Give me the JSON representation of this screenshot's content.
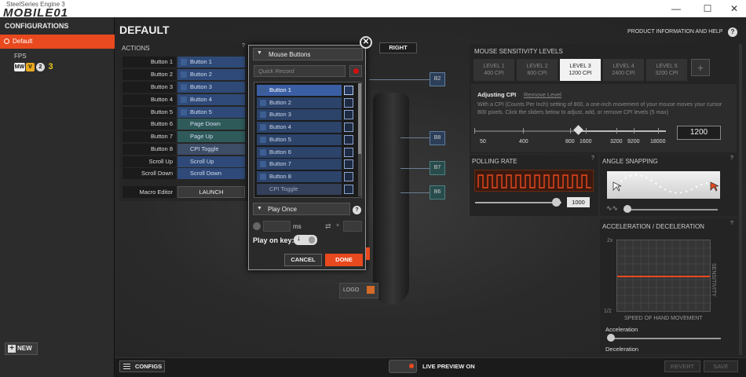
{
  "window": {
    "app_title": "SteelSeries Engine 3",
    "logo_text": "MOBILE01",
    "minimize": "—",
    "maximize": "☐",
    "close": "✕"
  },
  "sidebar": {
    "title": "CONFIGURATIONS",
    "default_item": "Default",
    "fps_item": "FPS",
    "new_button": "NEW",
    "new_icon": "+"
  },
  "main": {
    "title": "DEFAULT",
    "product_info": "PRODUCT INFORMATION AND HELP",
    "product_info_icon": "?",
    "right_tab": "RIGHT"
  },
  "actions": {
    "title": "ACTIONS",
    "help": "?",
    "rows": [
      {
        "label": "Button 1",
        "value": "Button 1"
      },
      {
        "label": "Button 2",
        "value": "Button 2"
      },
      {
        "label": "Button 3",
        "value": "Button 3"
      },
      {
        "label": "Button 4",
        "value": "Button 4"
      },
      {
        "label": "Button 5",
        "value": "Button 5"
      },
      {
        "label": "Button 6",
        "value": "Page Down"
      },
      {
        "label": "Button 7",
        "value": "Page Up"
      },
      {
        "label": "Button 8",
        "value": "CPI Toggle"
      },
      {
        "label": "Scroll Up",
        "value": "Scroll Up"
      },
      {
        "label": "Scroll Down",
        "value": "Scroll Down"
      }
    ],
    "macro_label": "Macro Editor",
    "launch": "LAUNCH"
  },
  "mouse": {
    "callouts": [
      "B2",
      "B8",
      "B7",
      "B6"
    ],
    "logo_label": "LOGO"
  },
  "popup": {
    "close": "✕",
    "header": "Mouse Buttons",
    "quick_record_placeholder": "Quick Record",
    "items": [
      "Button 1",
      "Button 2",
      "Button 3",
      "Button 4",
      "Button 5",
      "Button 6",
      "Button 7",
      "Button 8",
      "CPI Toggle"
    ],
    "play_mode": "Play Once",
    "play_help": "?",
    "ms_label": "ms",
    "times_label": "×",
    "play_on_key": "Play on key:",
    "cancel": "CANCEL",
    "done": "DONE"
  },
  "sensitivity": {
    "title": "MOUSE SENSITIVITY LEVELS",
    "levels": [
      {
        "name": "LEVEL 1",
        "cpi": "400 CPI"
      },
      {
        "name": "LEVEL 2",
        "cpi": "800 CPI"
      },
      {
        "name": "LEVEL 3",
        "cpi": "1200 CPI"
      },
      {
        "name": "LEVEL 4",
        "cpi": "2400 CPI"
      },
      {
        "name": "LEVEL 5",
        "cpi": "3200 CPI"
      }
    ],
    "active_level": 3,
    "add": "+",
    "adjusting": "Adjusting CPI",
    "remove": "Remove Level",
    "description": "With a CPI (Counts Per Inch) setting of 800, a one-inch movement of your mouse moves your cursor 800 pixels. Click the sliders below to adjust, add, or remove CPI levels (5 max)",
    "ticks": [
      "50",
      "400",
      "800",
      "1600",
      "3200",
      "9200",
      "18000"
    ],
    "value": "1200"
  },
  "polling": {
    "title": "POLLING RATE",
    "help": "?",
    "value": "1000"
  },
  "angle": {
    "title": "ANGLE SNAPPING",
    "help": "?",
    "wave_icon": "∿∿"
  },
  "accel": {
    "title": "ACCELERATION / DECELERATION",
    "help": "?",
    "y_max": "2x",
    "y_min": "1/2",
    "y_label": "SENSITIVITY",
    "x_label": "SPEED OF HAND MOVEMENT",
    "accel_label": "Acceleration",
    "decel_label": "Deceleration"
  },
  "bottom": {
    "configs": "CONFIGS",
    "live_preview": "LIVE PREVIEW ON",
    "revert": "REVERT",
    "save": "SAVE"
  },
  "colors": {
    "accent": "#e8491e",
    "button_blue": "#2f4a78",
    "teal": "#2f5a5a"
  }
}
